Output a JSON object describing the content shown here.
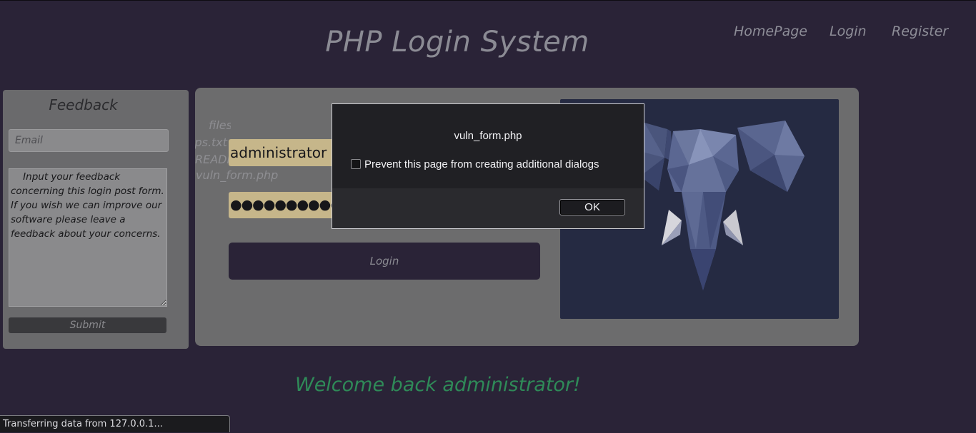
{
  "site": {
    "title": "PHP Login System",
    "nav": [
      "HomePage",
      "Login",
      "Register"
    ]
  },
  "feedback": {
    "title": "Feedback",
    "email_placeholder": "Email",
    "message": "    Input your feedback concerning this login post form. If you wish we can improve our software please leave a feedback about your concerns.",
    "submit_label": "Submit"
  },
  "files": [
    "files",
    "ips.txt",
    "README",
    "vuln_form.php"
  ],
  "login_form": {
    "username": "administrator",
    "password_mask": "●●●●●●●●●●",
    "button_label": "Login"
  },
  "welcome": "Welcome back administrator!",
  "dialog": {
    "message": "vuln_form.php",
    "checkbox_label": "Prevent this page from creating additional dialogs",
    "ok_label": "OK"
  },
  "statusbar": "Transferring data from 127.0.0.1...",
  "colors": {
    "background": "#2a2337",
    "card": "#6c6c6d",
    "input_fill": "#c6b68a",
    "welcome_text": "#2f8a58",
    "elephant_panel": "#252a42"
  }
}
